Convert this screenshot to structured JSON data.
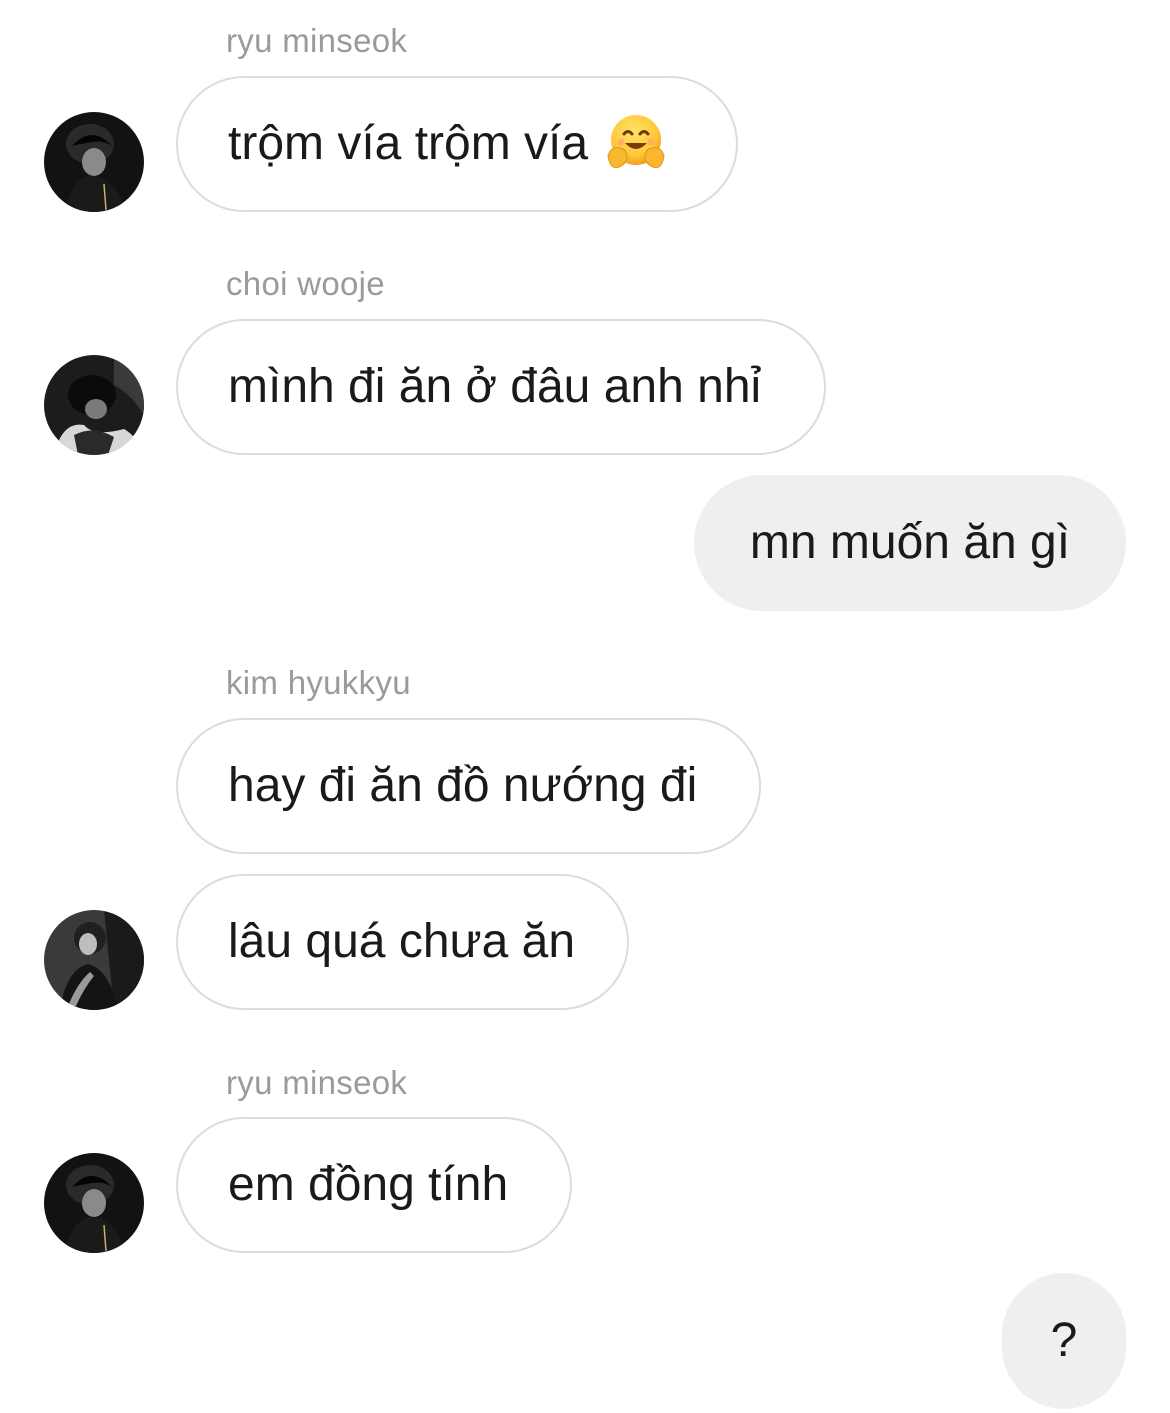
{
  "messages": [
    {
      "sender": "ryu minseok",
      "text": "trộm vía trộm vía",
      "emoji": "hugging-face-emoji"
    },
    {
      "sender": "choi wooje",
      "text": "mình đi ăn ở đâu anh nhỉ"
    },
    {
      "text": "mn muốn ăn gì"
    },
    {
      "sender": "kim hyukkyu",
      "text": "hay đi ăn đồ nướng đi"
    },
    {
      "text": "lâu quá chưa ăn"
    },
    {
      "sender": "ryu minseok",
      "text": "em đồng tính"
    },
    {
      "text": "?"
    }
  ],
  "colors": {
    "incoming_bubble_bg": "#ffffff",
    "incoming_bubble_border": "#dcdcdc",
    "outgoing_bubble_bg": "#efefef",
    "sender_name": "#9a9a9a",
    "message_text": "#1a1a1a"
  }
}
